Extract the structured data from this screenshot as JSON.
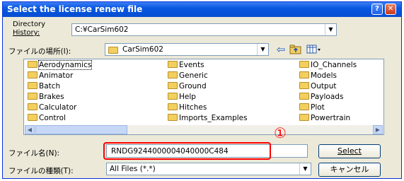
{
  "window": {
    "title": "Select the license renew file",
    "help_btn": "?",
    "close_btn": "✕"
  },
  "history": {
    "label_line1": "Directory",
    "label_line2": "History:",
    "value": "C:¥CarSim602"
  },
  "look_in": {
    "label": "ファイルの場所(I):",
    "value": "CarSim602"
  },
  "toolbar_icons": [
    "back-arrow-icon",
    "up-folder-icon",
    "view-menu-icon"
  ],
  "folders": {
    "col1": [
      "Aerodynamics",
      "Animator",
      "Batch",
      "Brakes",
      "Calculator",
      "Control"
    ],
    "col2": [
      "Events",
      "Generic",
      "Ground",
      "Help",
      "Hitches",
      "Imports_Examples"
    ],
    "col3": [
      "IO_Channels",
      "Models",
      "Output",
      "Payloads",
      "Plot",
      "Powertrain"
    ]
  },
  "filename": {
    "label": "ファイル名(N):",
    "value": "RNDG9244000004040000C484"
  },
  "filetype": {
    "label": "ファイルの種類(T):",
    "value": "All Files (*.*)"
  },
  "buttons": {
    "select": "Select",
    "cancel": "キャンセル"
  },
  "annotation": {
    "marker": "①"
  },
  "colors": {
    "title_bar": "#0a58e0",
    "highlight": "#ff0000",
    "dialog_bg": "#ece9d8"
  }
}
